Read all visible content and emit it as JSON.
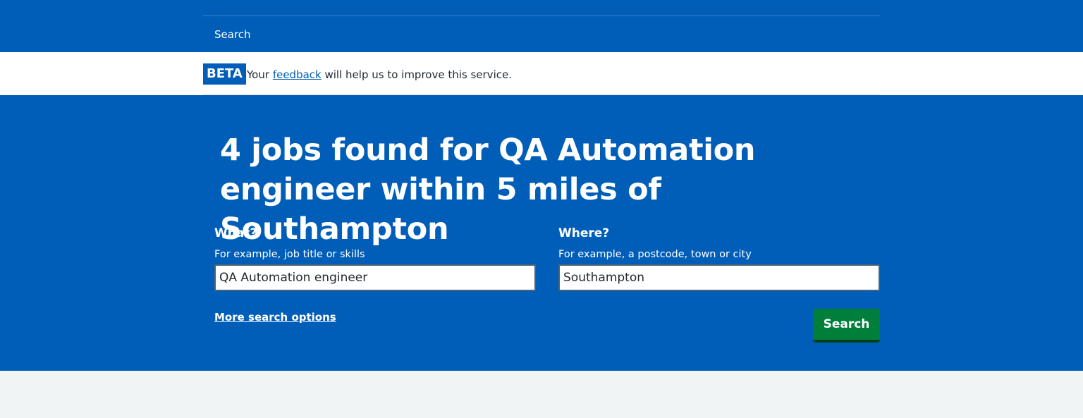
{
  "nav": {
    "search_label": "Search"
  },
  "beta_banner": {
    "tag": "BETA",
    "text_before": "Your",
    "link_text": "feedback",
    "text_after": "will help us to improve this service."
  },
  "results": {
    "title": "4 jobs found for QA Automation engineer within 5 miles of Southampton"
  },
  "search_form": {
    "what": {
      "label": "What?",
      "hint": "For example, job title or skills",
      "value": "QA Automation engineer"
    },
    "where": {
      "label": "Where?",
      "hint": "For example, a postcode, town or city",
      "value": "Southampton"
    },
    "more_options_label": "More search options",
    "submit_label": "Search"
  },
  "colors": {
    "brand_blue": "#005eb8",
    "button_green": "#007f3b",
    "page_background": "#f0f4f5"
  }
}
